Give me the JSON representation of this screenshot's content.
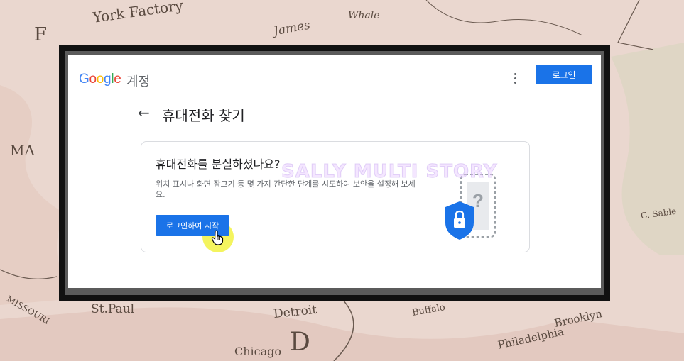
{
  "background": {
    "map_words": [
      "York Factory",
      "James",
      "Whale",
      "St.Paul",
      "Detroit",
      "Brooklyn",
      "Philadelphia",
      "Chicago",
      "F",
      "D",
      "MA",
      "MISSOURI",
      "Buffalo",
      "C. Sable"
    ]
  },
  "header": {
    "logo_letters": [
      "G",
      "o",
      "o",
      "g",
      "l",
      "e"
    ],
    "account_label": "계정",
    "login_button": "로그인"
  },
  "page": {
    "title": "휴대전화 찾기"
  },
  "card": {
    "title": "휴대전화를 분실하셨나요?",
    "description": "위치 표시나 화면 잠그기 등 몇 가지 간단한 단계를 시도하여 보안을 설정해 보세요.",
    "start_button": "로그인하여 시작"
  },
  "watermark": "SALLY MULTI STORY",
  "colors": {
    "accent": "#1a73e8",
    "shield": "#1a73e8",
    "frame": "#111111"
  },
  "icons": [
    "more-vert-icon",
    "back-arrow-icon",
    "shield-lock-icon",
    "phone-question-icon",
    "hand-cursor-icon"
  ]
}
